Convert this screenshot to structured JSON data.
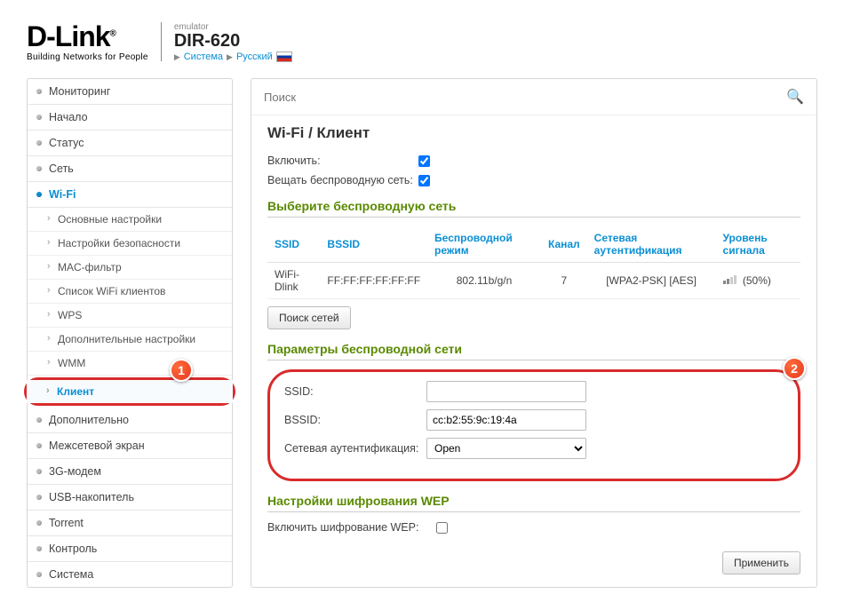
{
  "header": {
    "logo_main": "D-Link",
    "logo_sub": "Building Networks for People",
    "emulator": "emulator",
    "model": "DIR-620",
    "bc_system": "Система",
    "bc_lang": "Русский"
  },
  "sidebar": {
    "items": [
      {
        "label": "Мониторинг"
      },
      {
        "label": "Начало"
      },
      {
        "label": "Статус"
      },
      {
        "label": "Сеть"
      },
      {
        "label": "Wi-Fi"
      },
      {
        "label": "Дополнительно"
      },
      {
        "label": "Межсетевой экран"
      },
      {
        "label": "3G-модем"
      },
      {
        "label": "USB-накопитель"
      },
      {
        "label": "Torrent"
      },
      {
        "label": "Контроль"
      },
      {
        "label": "Система"
      }
    ],
    "wifi_sub": [
      {
        "label": "Основные настройки"
      },
      {
        "label": "Настройки безопасности"
      },
      {
        "label": "MAC-фильтр"
      },
      {
        "label": "Список WiFi клиентов"
      },
      {
        "label": "WPS"
      },
      {
        "label": "Дополнительные настройки"
      },
      {
        "label": "WMM"
      },
      {
        "label": "Клиент"
      }
    ]
  },
  "search": {
    "placeholder": "Поиск"
  },
  "page_title": "Wi-Fi /  Клиент",
  "toggles": {
    "enable_label": "Включить:",
    "broadcast_label": "Вещать беспроводную сеть:",
    "enable_checked": true,
    "broadcast_checked": true
  },
  "net_section": {
    "heading": "Выберите беспроводную сеть",
    "cols": [
      "SSID",
      "BSSID",
      "Беспроводной режим",
      "Канал",
      "Сетевая аутентификация",
      "Уровень сигнала"
    ],
    "row": {
      "ssid": "WiFi-Dlink",
      "bssid": "FF:FF:FF:FF:FF:FF",
      "mode": "802.11b/g/n",
      "channel": "7",
      "auth": "[WPA2-PSK] [AES]",
      "signal": "(50%)"
    },
    "scan_btn": "Поиск сетей"
  },
  "params": {
    "heading": "Параметры беспроводной сети",
    "ssid_label": "SSID:",
    "ssid_value": "",
    "bssid_label": "BSSID:",
    "bssid_value": "cc:b2:55:9c:19:4a",
    "auth_label": "Сетевая аутентификация:",
    "auth_value": "Open"
  },
  "wep": {
    "heading": "Настройки шифрования WEP",
    "enable_label": "Включить шифрование WEP:",
    "enable_checked": false
  },
  "apply_btn": "Применить",
  "badges": {
    "one": "1",
    "two": "2"
  }
}
